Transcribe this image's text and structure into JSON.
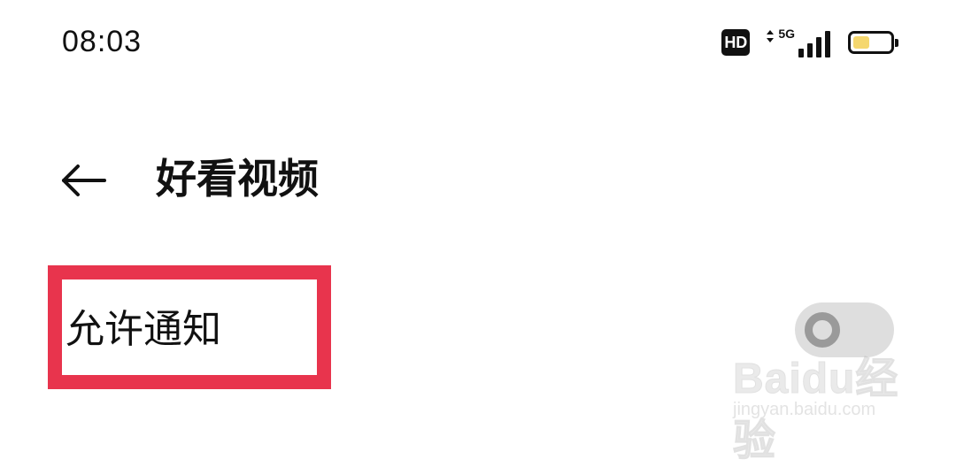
{
  "status_bar": {
    "time": "08:03",
    "hd_badge": "HD",
    "network_label": "5G",
    "battery_level": 0.45,
    "battery_color": "#f5d76e"
  },
  "header": {
    "back_icon": "arrow-left-icon",
    "title": "好看视频"
  },
  "setting": {
    "label": "允许通知",
    "toggle_state": "off",
    "highlight_color": "#e8344d"
  },
  "watermark": {
    "brand": "Baidu经验",
    "url": "jingyan.baidu.com"
  }
}
